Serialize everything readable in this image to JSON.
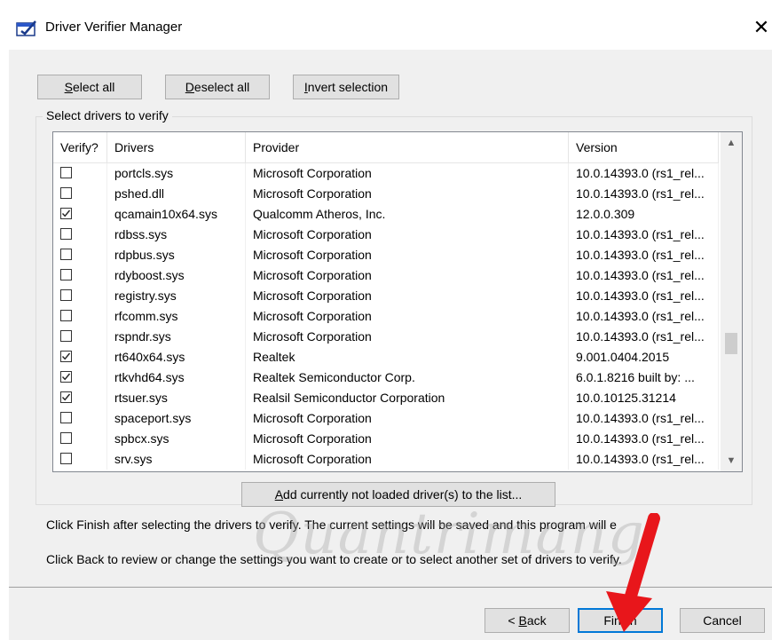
{
  "window": {
    "title": "Driver Verifier Manager",
    "close_glyph": "✕",
    "icon": "driver-verifier-icon"
  },
  "toolbar": {
    "select_all": {
      "mnemonic": "S",
      "rest": "elect all"
    },
    "deselect_all": {
      "mnemonic": "D",
      "rest": "eselect all"
    },
    "invert_selection": {
      "mnemonic": "I",
      "rest": "nvert selection"
    }
  },
  "group_label": "Select drivers to verify",
  "columns": {
    "verify": "Verify?",
    "drivers": "Drivers",
    "provider": "Provider",
    "version": "Version"
  },
  "drivers": [
    {
      "checked": false,
      "name": "portcls.sys",
      "provider": "Microsoft Corporation",
      "version": "10.0.14393.0 (rs1_rel..."
    },
    {
      "checked": false,
      "name": "pshed.dll",
      "provider": "Microsoft Corporation",
      "version": "10.0.14393.0 (rs1_rel..."
    },
    {
      "checked": true,
      "name": "qcamain10x64.sys",
      "provider": "Qualcomm Atheros, Inc.",
      "version": "12.0.0.309"
    },
    {
      "checked": false,
      "name": "rdbss.sys",
      "provider": "Microsoft Corporation",
      "version": "10.0.14393.0 (rs1_rel..."
    },
    {
      "checked": false,
      "name": "rdpbus.sys",
      "provider": "Microsoft Corporation",
      "version": "10.0.14393.0 (rs1_rel..."
    },
    {
      "checked": false,
      "name": "rdyboost.sys",
      "provider": "Microsoft Corporation",
      "version": "10.0.14393.0 (rs1_rel..."
    },
    {
      "checked": false,
      "name": "registry.sys",
      "provider": "Microsoft Corporation",
      "version": "10.0.14393.0 (rs1_rel..."
    },
    {
      "checked": false,
      "name": "rfcomm.sys",
      "provider": "Microsoft Corporation",
      "version": "10.0.14393.0 (rs1_rel..."
    },
    {
      "checked": false,
      "name": "rspndr.sys",
      "provider": "Microsoft Corporation",
      "version": "10.0.14393.0 (rs1_rel..."
    },
    {
      "checked": true,
      "name": "rt640x64.sys",
      "provider": "Realtek",
      "version": "9.001.0404.2015"
    },
    {
      "checked": true,
      "name": "rtkvhd64.sys",
      "provider": "Realtek Semiconductor Corp.",
      "version": "6.0.1.8216 built by: ..."
    },
    {
      "checked": true,
      "name": "rtsuer.sys",
      "provider": "Realsil Semiconductor Corporation",
      "version": "10.0.10125.31214"
    },
    {
      "checked": false,
      "name": "spaceport.sys",
      "provider": "Microsoft Corporation",
      "version": "10.0.14393.0 (rs1_rel..."
    },
    {
      "checked": false,
      "name": "spbcx.sys",
      "provider": "Microsoft Corporation",
      "version": "10.0.14393.0 (rs1_rel..."
    },
    {
      "checked": false,
      "name": "srv.sys",
      "provider": "Microsoft Corporation",
      "version": "10.0.14393.0 (rs1_rel..."
    }
  ],
  "add_button": {
    "mnemonic": "A",
    "rest": "dd currently not loaded driver(s) to the list..."
  },
  "info_lines": [
    "Click Finish after selecting the drivers to verify. The current settings will be saved and this program will e",
    "Click Back to review or change the settings you want to create or to select another set of drivers to verify."
  ],
  "footer": {
    "back": {
      "prefix": "< ",
      "mnemonic": "B",
      "rest": "ack"
    },
    "finish": "Finish",
    "cancel": "Cancel"
  },
  "watermark": "Quantrimang",
  "accent_color": "#0078d7",
  "arrow_color": "#e8161b"
}
